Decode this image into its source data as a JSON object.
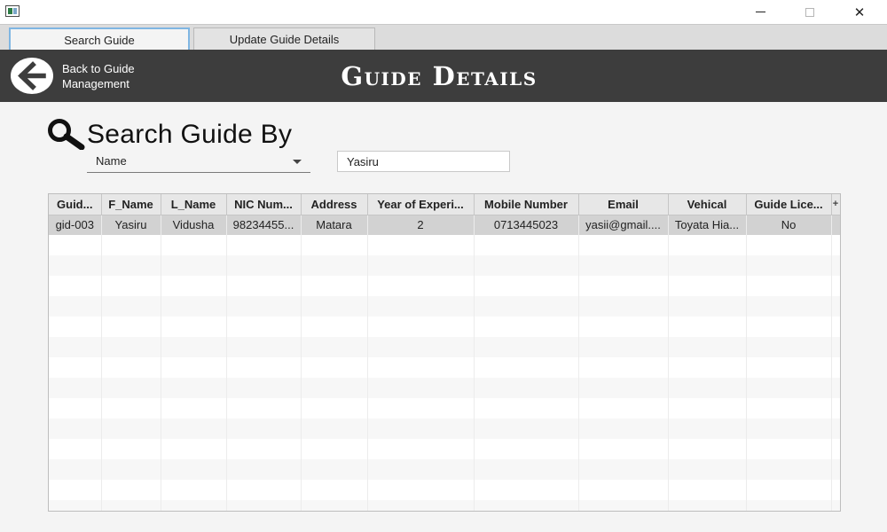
{
  "window": {
    "min_icon": "minimize-icon",
    "max_icon": "maximize-icon",
    "close_icon": "close-icon",
    "close_glyph": "✕"
  },
  "tabs": [
    {
      "label": "Search Guide",
      "active": true
    },
    {
      "label": "Update Guide Details",
      "active": false
    }
  ],
  "header": {
    "back_icon": "arrow-left-icon",
    "back_label": "Back to Guide Management",
    "title": "Guide Details"
  },
  "search": {
    "icon": "search-icon",
    "heading": "Search Guide By",
    "criteria_selected": "Name",
    "query_value": "Yasiru"
  },
  "table": {
    "columns": [
      "Guid...",
      "F_Name",
      "L_Name",
      "NIC Num...",
      "Address",
      "Year of Experi...",
      "Mobile Number",
      "Email",
      "Vehical",
      "Guide Lice..."
    ],
    "corner_glyph": "+",
    "rows": [
      {
        "selected": true,
        "cells": [
          "gid-003",
          "Yasiru",
          "Vidusha",
          "98234455...",
          "Matara",
          "2",
          "0713445023",
          "yasii@gmail....",
          "Toyata Hia...",
          "No"
        ]
      }
    ]
  },
  "colors": {
    "header_bg": "#3d3d3d",
    "active_tab_border": "#7fb6e3",
    "selected_row": "#d2d2d2"
  }
}
